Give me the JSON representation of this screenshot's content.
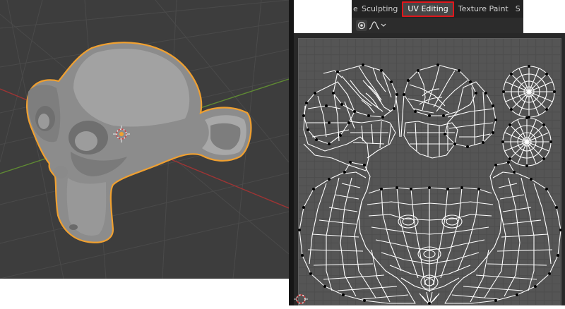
{
  "workspace_tabs": [
    {
      "label": "eling",
      "active": false
    },
    {
      "label": "Sculpting",
      "active": false
    },
    {
      "label": "UV Editing",
      "active": true
    },
    {
      "label": "Texture Paint",
      "active": false
    },
    {
      "label": "S",
      "active": false
    }
  ],
  "colors": {
    "viewport_background": "#3d3d3d",
    "selection_outline": "#f0a030",
    "active_tab_highlight": "#e0161b",
    "uv_background": "#555555",
    "grid_x_axis": "#b23a3a",
    "grid_y_axis": "#6a9a3a"
  },
  "icons": {
    "pivot": "pivot-point-icon",
    "proportional_falloff": "falloff-curve-icon",
    "dropdown": "chevron-down-icon",
    "origin": "object-origin-icon",
    "cursor_2d": "2d-cursor-icon"
  }
}
